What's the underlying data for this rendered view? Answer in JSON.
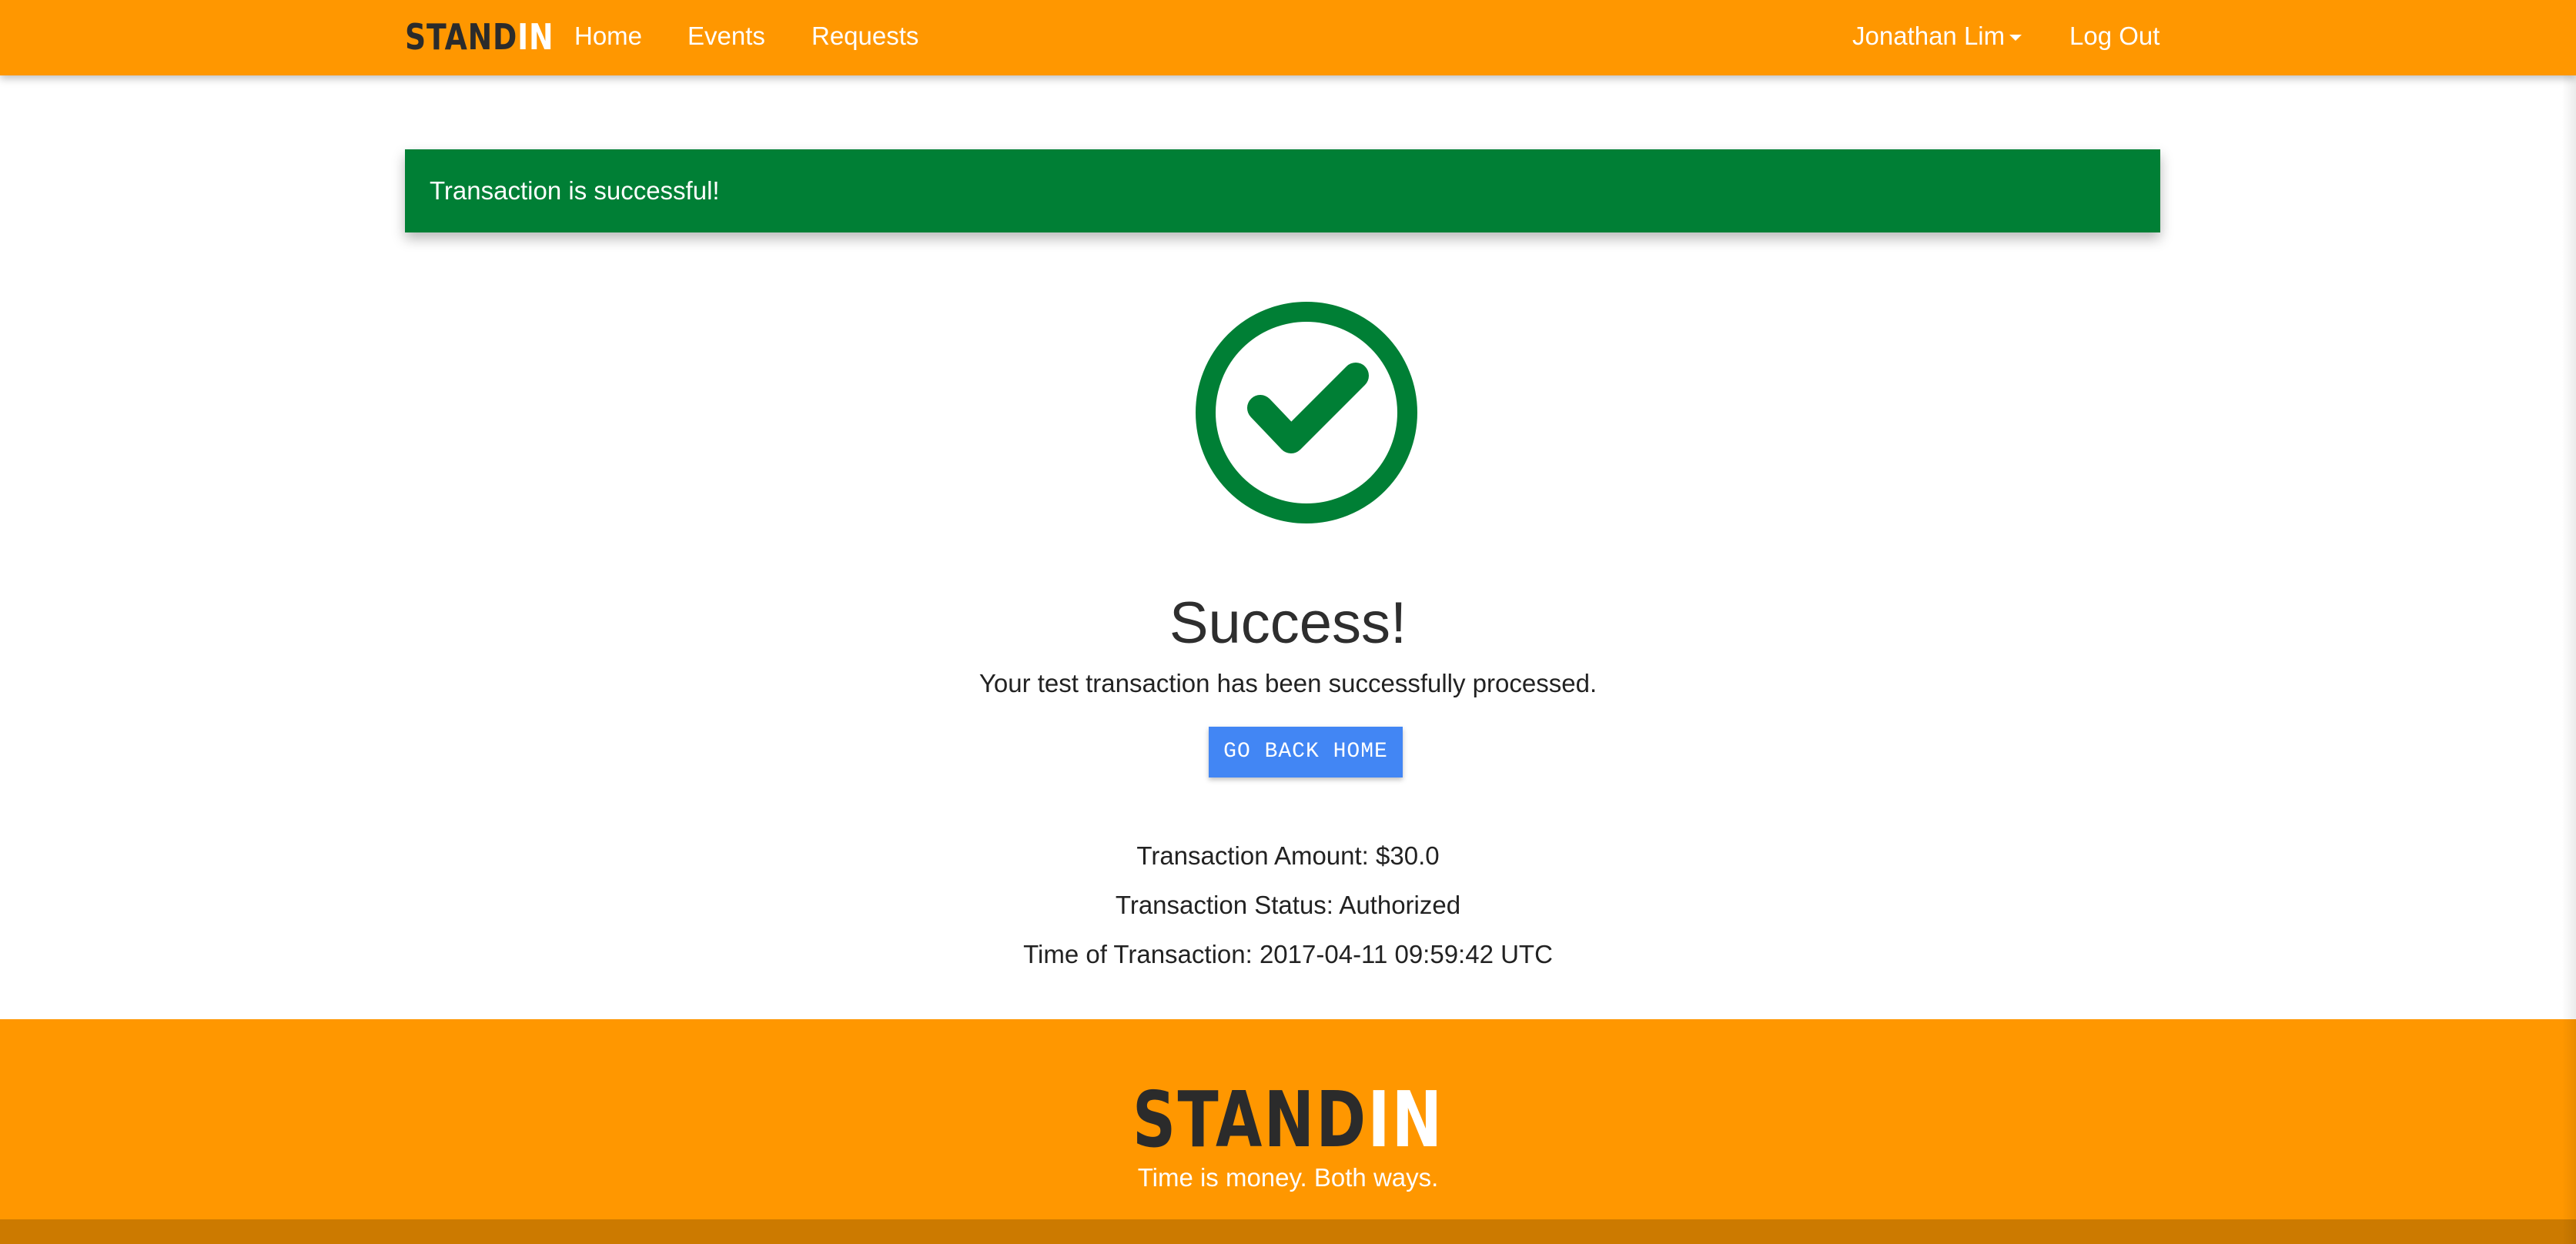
{
  "nav": {
    "brand_part1": "STAND",
    "brand_part2": "IN",
    "links": [
      {
        "label": "Home"
      },
      {
        "label": "Events"
      },
      {
        "label": "Requests"
      }
    ],
    "user_menu": "Jonathan Lim",
    "logout": "Log Out"
  },
  "alert": {
    "message": "Transaction is successful!"
  },
  "success": {
    "icon": "check-circle-icon",
    "title": "Success!",
    "subtitle": "Your test transaction has been successfully processed.",
    "button_label": "GO BACK HOME"
  },
  "transaction": {
    "amount": "Transaction Amount: $30.0",
    "status": "Transaction Status: Authorized",
    "time": "Time of Transaction: 2017-04-11 09:59:42 UTC"
  },
  "footer": {
    "brand_part1": "STAND",
    "brand_part2": "IN",
    "tagline": "Time is money. Both ways."
  },
  "colors": {
    "primary_orange": "#ff9700",
    "success_green": "#007f35",
    "button_blue": "#4286f4",
    "footer_dark_orange": "#cc7a00"
  }
}
